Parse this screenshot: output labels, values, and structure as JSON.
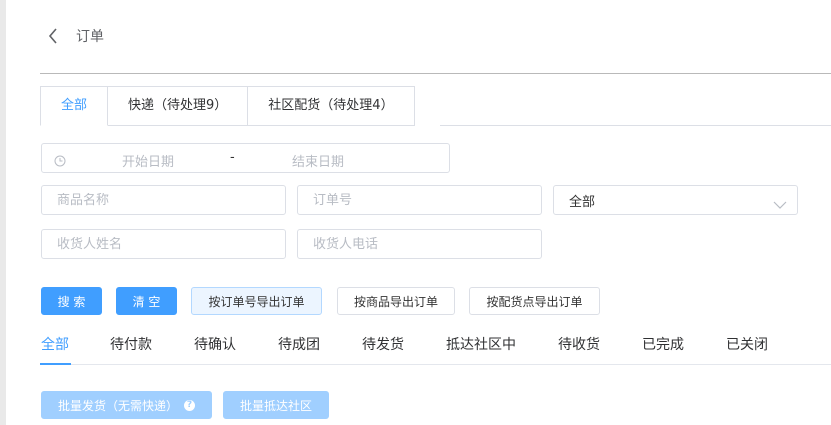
{
  "header": {
    "title": "订单"
  },
  "tabs": [
    {
      "label": "全部"
    },
    {
      "label": "快递（待处理9）"
    },
    {
      "label": "社区配货（待处理4）"
    }
  ],
  "filters": {
    "start_date_placeholder": "开始日期",
    "date_separator": "-",
    "end_date_placeholder": "结束日期",
    "product_name_placeholder": "商品名称",
    "order_no_placeholder": "订单号",
    "status_select_value": "全部",
    "receiver_name_placeholder": "收货人姓名",
    "receiver_phone_placeholder": "收货人电话"
  },
  "actions": {
    "search": "搜 索",
    "clear": "清 空",
    "export_by_order": "按订单号导出订单",
    "export_by_product": "按商品导出订单",
    "export_by_point": "按配货点导出订单"
  },
  "status_tabs": [
    "全部",
    "待付款",
    "待确认",
    "待成团",
    "待发货",
    "抵达社区中",
    "待收货",
    "已完成",
    "已关闭"
  ],
  "batch": {
    "ship_no_express": "批量发货（无需快递）",
    "help_glyph": "?",
    "arrive_community": "批量抵达社区"
  },
  "icons": {
    "back": "chevron-left-icon",
    "clock": "clock-icon",
    "dropdown": "chevron-down-icon",
    "help": "question-circle-icon"
  },
  "colors": {
    "accent": "#409eff",
    "disabled": "#a0cfff",
    "border": "#dcdfe6",
    "placeholder": "#b8bcc4"
  }
}
